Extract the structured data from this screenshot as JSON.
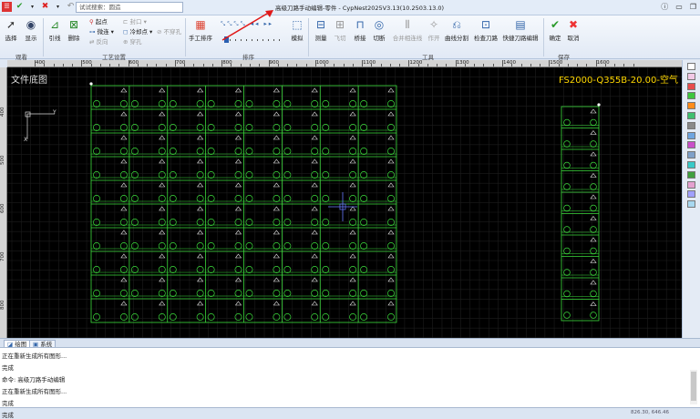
{
  "window": {
    "title": "高级刀路手动编辑-零件 - CypNest2025V3.13(10.2503.13.0)",
    "search_placeholder": "试试搜索：圆造"
  },
  "ribbon": {
    "select_label": "选择",
    "display_label": "显示",
    "lead_label": "引线",
    "delete_label": "删除",
    "start_point_label": "起点",
    "seal_label": "封口",
    "micro_joint_label": "微连",
    "cooling_label": "冷却点",
    "reverse_label": "反向",
    "pierce_label": "穿孔",
    "no_pierce_label": "不穿孔",
    "manual_sort_label": "手工排序",
    "simulate_label": "模拟",
    "measure_label": "测量",
    "fly_cut_label": "飞切",
    "bridge_label": "桥接",
    "cut_off_label": "切断",
    "common_edge_label": "合并相连线",
    "make_label": "作开",
    "curve_split_label": "曲线分割",
    "check_path_label": "检查刀路",
    "quick_edit_label": "快捷刀路编辑",
    "confirm_label": "确定",
    "cancel_label": "取消",
    "groups": {
      "view": "观看",
      "process": "工艺设置",
      "sort": "排序",
      "tools": "工具",
      "save": "保存"
    }
  },
  "ruler": {
    "top_labels": [
      "400",
      "500",
      "600",
      "700",
      "800",
      "900",
      "1000",
      "1100",
      "1200",
      "1300",
      "1400",
      "1500",
      "1600"
    ],
    "left_labels": [
      "400",
      "500",
      "600",
      "700",
      "800"
    ]
  },
  "canvas": {
    "layer_label": "文件底图",
    "material_label": "FS2000-Q355B-20.00-空气",
    "axis_x": "X",
    "axis_y": "Y",
    "colors": {
      "background": "#000000",
      "part": "#3cdc3c",
      "grid": "#1d1d1d",
      "material_text": "#ffd700"
    }
  },
  "tabs": {
    "drawing": "绘图",
    "system": "系统"
  },
  "command_log": [
    "正在重新生成所有图形...",
    "完成",
    "命令: 高级刀路手动编辑",
    "正在重新生成所有图形...",
    "完成"
  ],
  "status": {
    "text": "完成",
    "coords": "826.30, 646.46"
  },
  "color_swatches": [
    "#ffffff",
    "#f2c9e6",
    "#e84c4c",
    "#3ec63e",
    "#ff8c1a",
    "#3fbf6f",
    "#8a8a8a",
    "#6fa5e0",
    "#c94fc9",
    "#7fa0c9",
    "#38c9c9",
    "#3f9f3f",
    "#e4a0d0",
    "#a0a0ff",
    "#a8d8f0"
  ]
}
